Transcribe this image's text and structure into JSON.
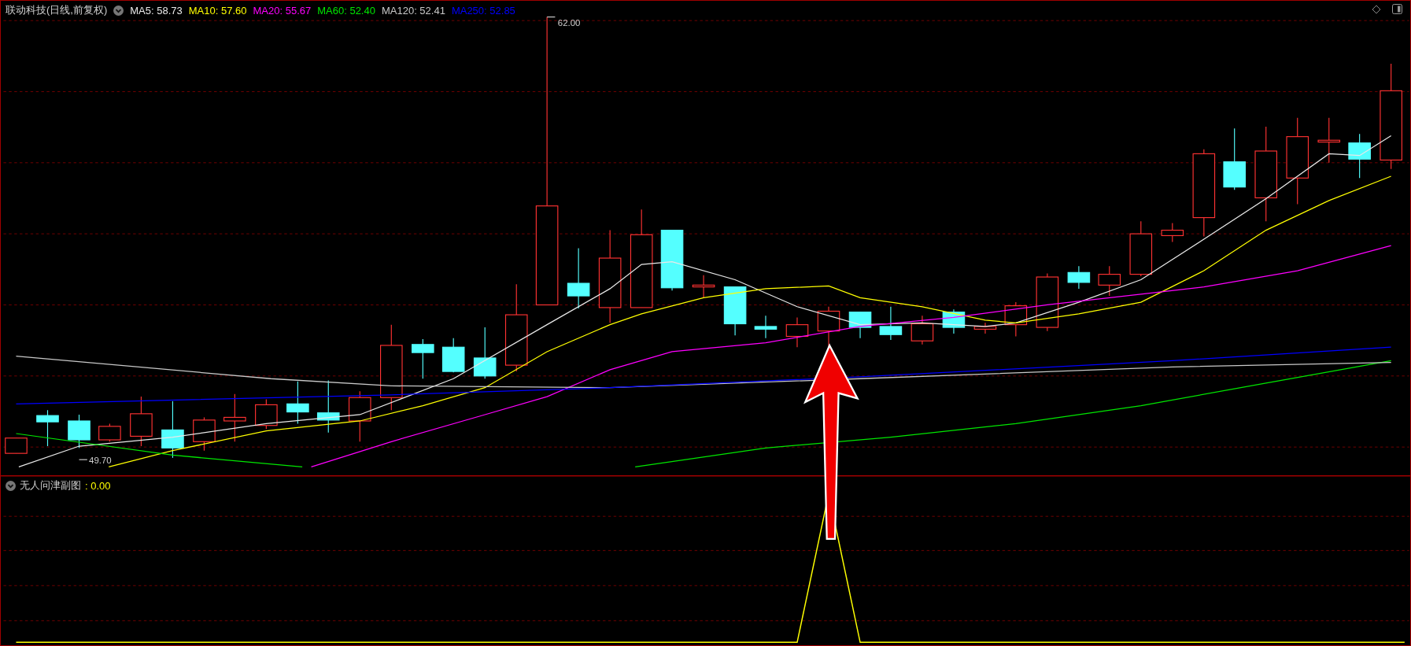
{
  "title": "联动科技(日线,前复权)",
  "moving_averages": [
    {
      "label": "MA5: 58.73",
      "color": "#e8e8e8"
    },
    {
      "label": "MA10: 57.60",
      "color": "#ffff00"
    },
    {
      "label": "MA20: 55.67",
      "color": "#ff00ff"
    },
    {
      "label": "MA60: 52.40",
      "color": "#00e600"
    },
    {
      "label": "MA120: 52.41",
      "color": "#c8c8c8"
    },
    {
      "label": "MA250: 52.85",
      "color": "#0000ff"
    }
  ],
  "price_labels": {
    "high": "62.00",
    "low": "49.70"
  },
  "indicator": {
    "name": "无人问津副图",
    "value": ": 0.00"
  }
}
